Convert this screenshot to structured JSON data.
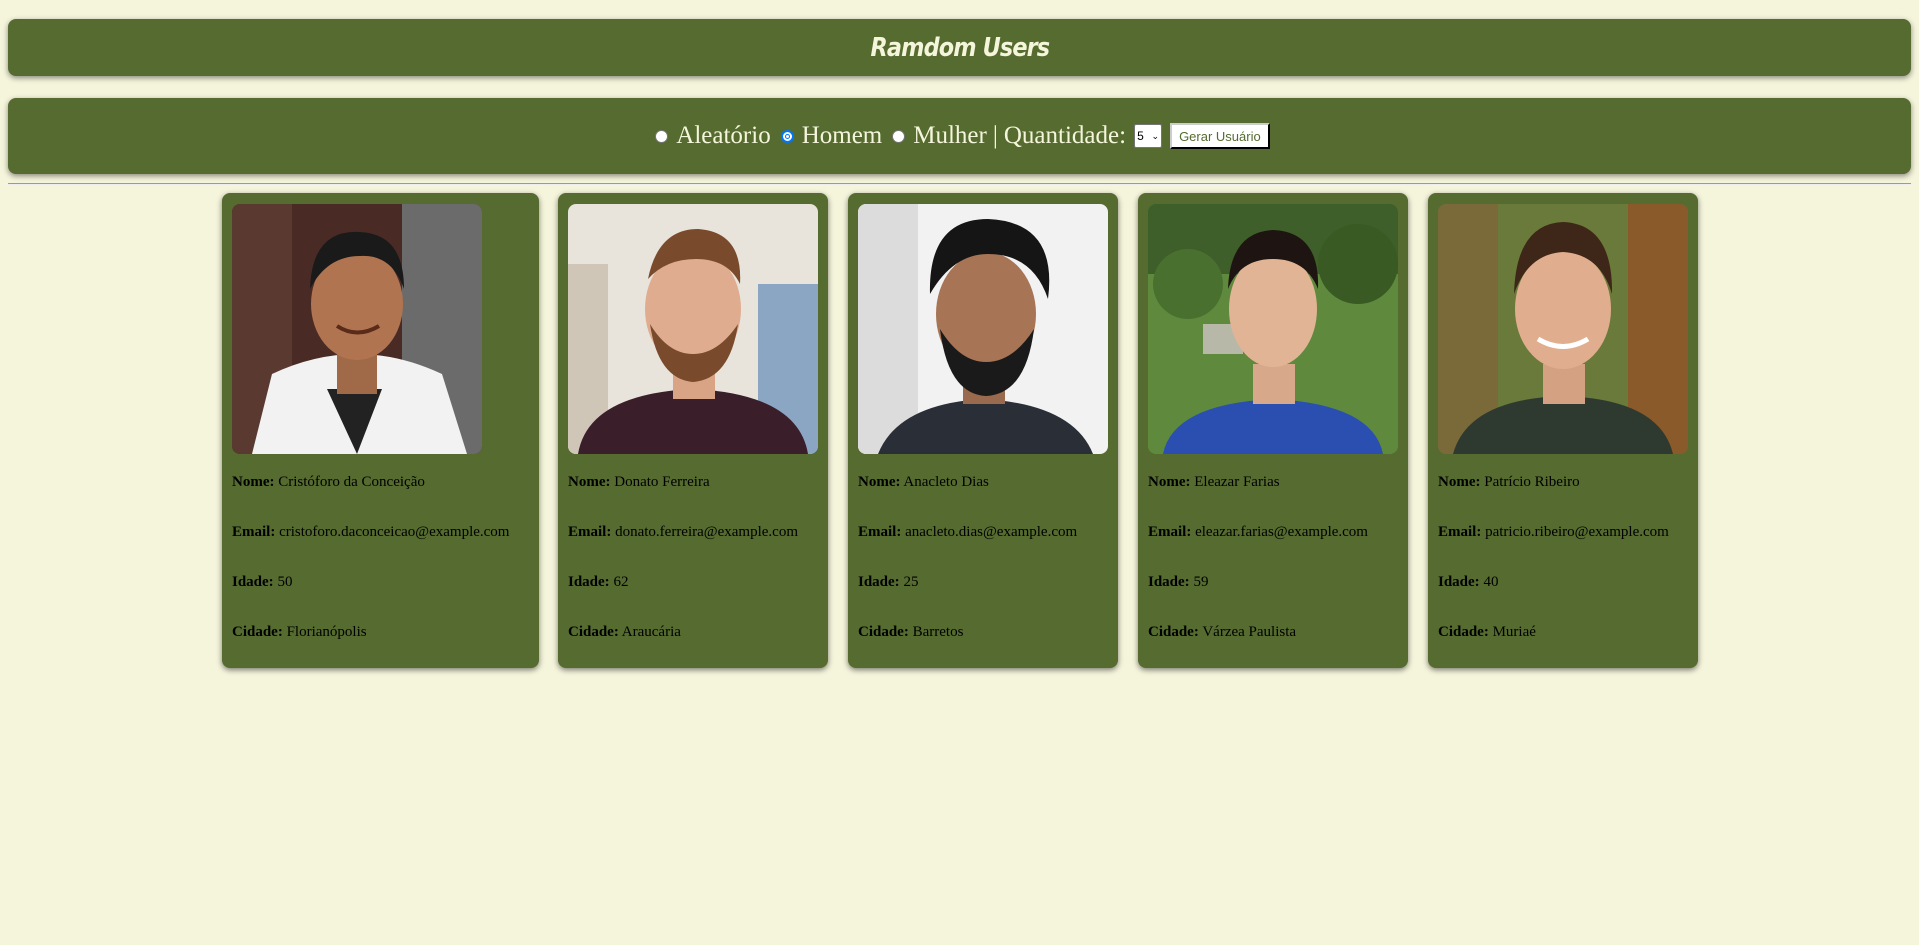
{
  "header": {
    "title": "Ramdom Users"
  },
  "controls": {
    "options": [
      {
        "label": "Aleatório",
        "checked": false
      },
      {
        "label": "Homem",
        "checked": true
      },
      {
        "label": "Mulher",
        "checked": false
      }
    ],
    "separator": "|",
    "quantity_label": "Quantidade:",
    "quantity_value": "5",
    "generate_button": "Gerar Usuário"
  },
  "labels": {
    "name": "Nome:",
    "email": "Email:",
    "age": "Idade:",
    "city": "Cidade:"
  },
  "users": [
    {
      "name": "Cristóforo da Conceição",
      "email": "cristoforo.daconceicao@example.com",
      "age": "50",
      "city": "Florianópolis"
    },
    {
      "name": "Donato Ferreira",
      "email": "donato.ferreira@example.com",
      "age": "62",
      "city": "Araucária"
    },
    {
      "name": "Anacleto Dias",
      "email": "anacleto.dias@example.com",
      "age": "25",
      "city": "Barretos"
    },
    {
      "name": "Eleazar Farias",
      "email": "eleazar.farias@example.com",
      "age": "59",
      "city": "Várzea Paulista"
    },
    {
      "name": "Patrício Ribeiro",
      "email": "patricio.ribeiro@example.com",
      "age": "40",
      "city": "Muriaé"
    }
  ],
  "colors": {
    "panel": "#556b2f",
    "background": "#f5f5dc",
    "text_light": "#f5f5dc"
  }
}
